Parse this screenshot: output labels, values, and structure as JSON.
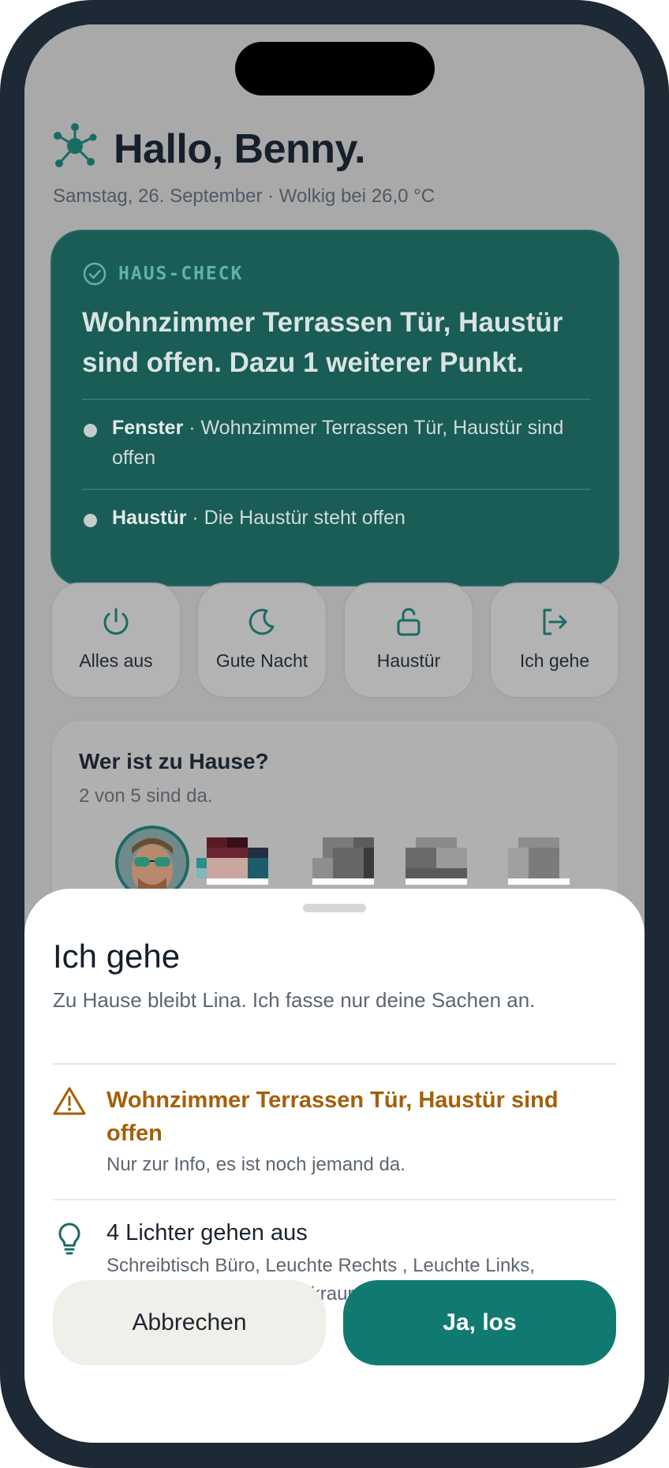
{
  "header": {
    "greeting": "Hallo, Benny.",
    "subline": "Samstag, 26. September · Wolkig bei 26,0 °C",
    "logo_icon": "molecule-logo-icon"
  },
  "haus_check": {
    "label": "HAUS-CHECK",
    "title": "Wohnzimmer Terrassen Tür, Haustür sind offen. Dazu 1 weiterer Punkt.",
    "items": [
      {
        "name": "Fenster",
        "text": " · Wohnzimmer Terrassen Tür, Haustür sind offen"
      },
      {
        "name": "Haustür",
        "text": " · Die Haustür steht offen"
      }
    ]
  },
  "actions": [
    {
      "label": "Alles aus",
      "icon": "power-icon"
    },
    {
      "label": "Gute Nacht",
      "icon": "moon-icon"
    },
    {
      "label": "Haustür",
      "icon": "unlock-icon"
    },
    {
      "label": "Ich gehe",
      "icon": "exit-icon"
    }
  ],
  "home": {
    "title": "Wer ist zu Hause?",
    "subtitle": "2 von 5 sind da."
  },
  "sheet": {
    "title": "Ich gehe",
    "subtitle": "Zu Hause bleibt Lina. Ich fasse nur deine Sachen an.",
    "warning_title": "Wohnzimmer Terrassen Tür, Haustür sind offen",
    "warning_sub": "Nur zur Info, es ist noch jemand da.",
    "lights_title": "4 Lichter gehen aus",
    "lights_sub": "Schreibtisch Büro, Leuchte Rechts , Leuchte Links, BambuLab A1 Mini Druckraumbeleuchtung",
    "cancel_label": "Abbrechen",
    "confirm_label": "Ja, los"
  },
  "colors": {
    "accent": "#117a70",
    "warning": "#a45f07",
    "frame": "#1d2935"
  }
}
